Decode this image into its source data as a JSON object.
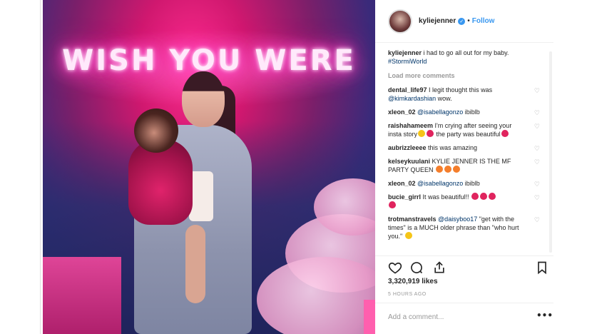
{
  "photo": {
    "neon_text": "WISH YOU WERE"
  },
  "header": {
    "username": "kyliejenner",
    "verified_glyph": "✓",
    "separator": "•",
    "follow_label": "Follow"
  },
  "caption": {
    "username": "kyliejenner",
    "text": " i had to go all out for my baby.",
    "hashtag": "#StormiWorld"
  },
  "load_more": "Load more comments",
  "comments": [
    {
      "user": "dental_life97",
      "text": " I legit thought this was ",
      "mention": "@kimkardashian",
      "after": " wow."
    },
    {
      "user": "xleon_02",
      "text": " ",
      "mention": "@isabellagonzo",
      "after": " ibiblb"
    },
    {
      "user": "raishahameem",
      "text": " I'm crying after seeing your insta story",
      "mention": "",
      "after": " the party was beautiful"
    },
    {
      "user": "aubrizzleeee",
      "text": " this was amazing",
      "mention": "",
      "after": ""
    },
    {
      "user": "kelseykuulani",
      "text": " KYLIE JENNER IS THE MF PARTY QUEEN ",
      "mention": "",
      "after": ""
    },
    {
      "user": "xleon_02",
      "text": " ",
      "mention": "@isabellagonzo",
      "after": " ibiblb"
    },
    {
      "user": "bucie_girrl",
      "text": " It was beautiful!! ",
      "mention": "",
      "after": ""
    },
    {
      "user": "trotmanstravels",
      "text": " ",
      "mention": "@daisyboo17",
      "after": " \"get with the times\" is a MUCH older phrase than \"who hurt you.\" "
    }
  ],
  "heart_glyph": "♡",
  "likes": "3,320,919 likes",
  "time": "5 HOURS AGO",
  "add_comment_placeholder": "Add a comment...",
  "more_glyph": "•••"
}
